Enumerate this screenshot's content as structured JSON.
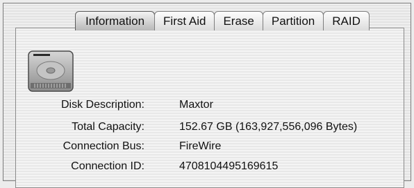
{
  "tabs": [
    {
      "label": "Information",
      "active": true
    },
    {
      "label": "First Aid",
      "active": false
    },
    {
      "label": "Erase",
      "active": false
    },
    {
      "label": "Partition",
      "active": false
    },
    {
      "label": "RAID",
      "active": false
    }
  ],
  "info": [
    {
      "label": "Disk Description:",
      "value": "Maxtor"
    },
    {
      "label": "Total Capacity:",
      "value": "152.67 GB (163,927,556,096 Bytes)"
    },
    {
      "label": "Connection Bus:",
      "value": "FireWire"
    },
    {
      "label": "Connection ID:",
      "value": "4708104495169615"
    }
  ]
}
